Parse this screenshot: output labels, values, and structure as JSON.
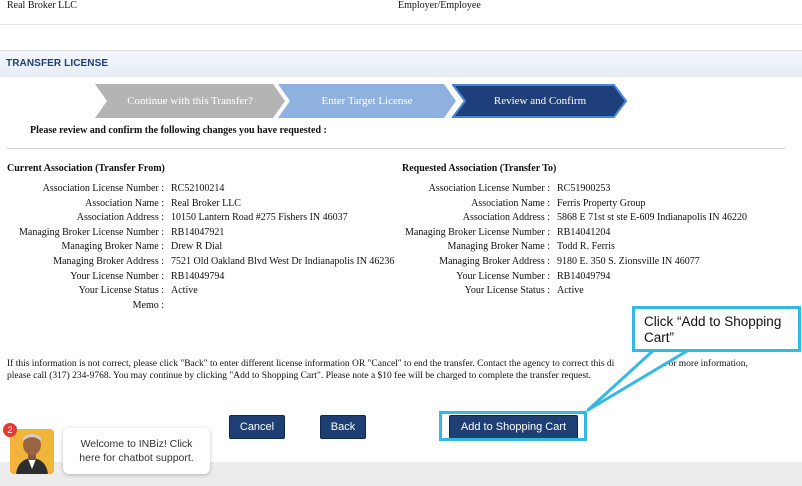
{
  "top_row": {
    "col1": "Real Broker LLC",
    "col2": "Employer/Employee"
  },
  "section_title": "TRANSFER LICENSE",
  "steps": [
    {
      "label": "Continue with this Transfer?",
      "color": "#b4b4b4"
    },
    {
      "label": "Enter Target License",
      "color": "#8fb1e0"
    },
    {
      "label": "Review and Confirm",
      "color": "#1f3f7a"
    }
  ],
  "intro_text": "Please review and confirm the following changes you have requested :",
  "current": {
    "title": "Current Association (Transfer From)",
    "fields": [
      {
        "label": "Association License Number :",
        "value": "RC52100214"
      },
      {
        "label": "Association Name :",
        "value": "Real Broker LLC"
      },
      {
        "label": "Association Address :",
        "value": "10150 Lantern Road #275 Fishers IN 46037"
      },
      {
        "label": "Managing Broker License Number :",
        "value": "RB14047921"
      },
      {
        "label": "Managing Broker Name :",
        "value": "Drew R Dial"
      },
      {
        "label": "Managing Broker Address :",
        "value": "7521 Old Oakland Blvd West Dr Indianapolis IN 46236"
      },
      {
        "label": "Your License Number :",
        "value": "RB14049794"
      },
      {
        "label": "Your License Status :",
        "value": "Active"
      },
      {
        "label": "Memo :",
        "value": ""
      }
    ]
  },
  "requested": {
    "title": "Requested Association (Transfer To)",
    "fields": [
      {
        "label": "Association License Number :",
        "value": "RC51900253"
      },
      {
        "label": "Association Name :",
        "value": "Ferris Property Group"
      },
      {
        "label": "Association Address :",
        "value": "5868 E 71st st ste E-609 Indianapolis IN 46220"
      },
      {
        "label": "Managing Broker License Number :",
        "value": "RB14041204"
      },
      {
        "label": "Managing Broker Name :",
        "value": "Todd R. Ferris"
      },
      {
        "label": "Managing Broker Address :",
        "value": "9180 E. 350 S. Zionsville IN 46077"
      },
      {
        "label": "Your License Number :",
        "value": "RB14049794"
      },
      {
        "label": "Your License Status :",
        "value": "Active"
      }
    ]
  },
  "notice_line1": "If this information is not correct, please click \"Back\" to enter different license information OR \"Cancel\" to end the transfer. Contact the agency to correct this di",
  "notice_line1_end": "y. For more information,",
  "notice_line2": "please call (317) 234-9768. You may continue by clicking \"Add to Shopping Cart\". Please note a $10 fee will be charged to complete the transfer request.",
  "buttons": {
    "cancel": "Cancel",
    "back": "Back",
    "add_to_cart": "Add to Shopping Cart"
  },
  "callout_text": "Click “Add to Shopping Cart”",
  "chat": {
    "badge": "2",
    "message": "Welcome to INBiz! Click here for chatbot support."
  }
}
